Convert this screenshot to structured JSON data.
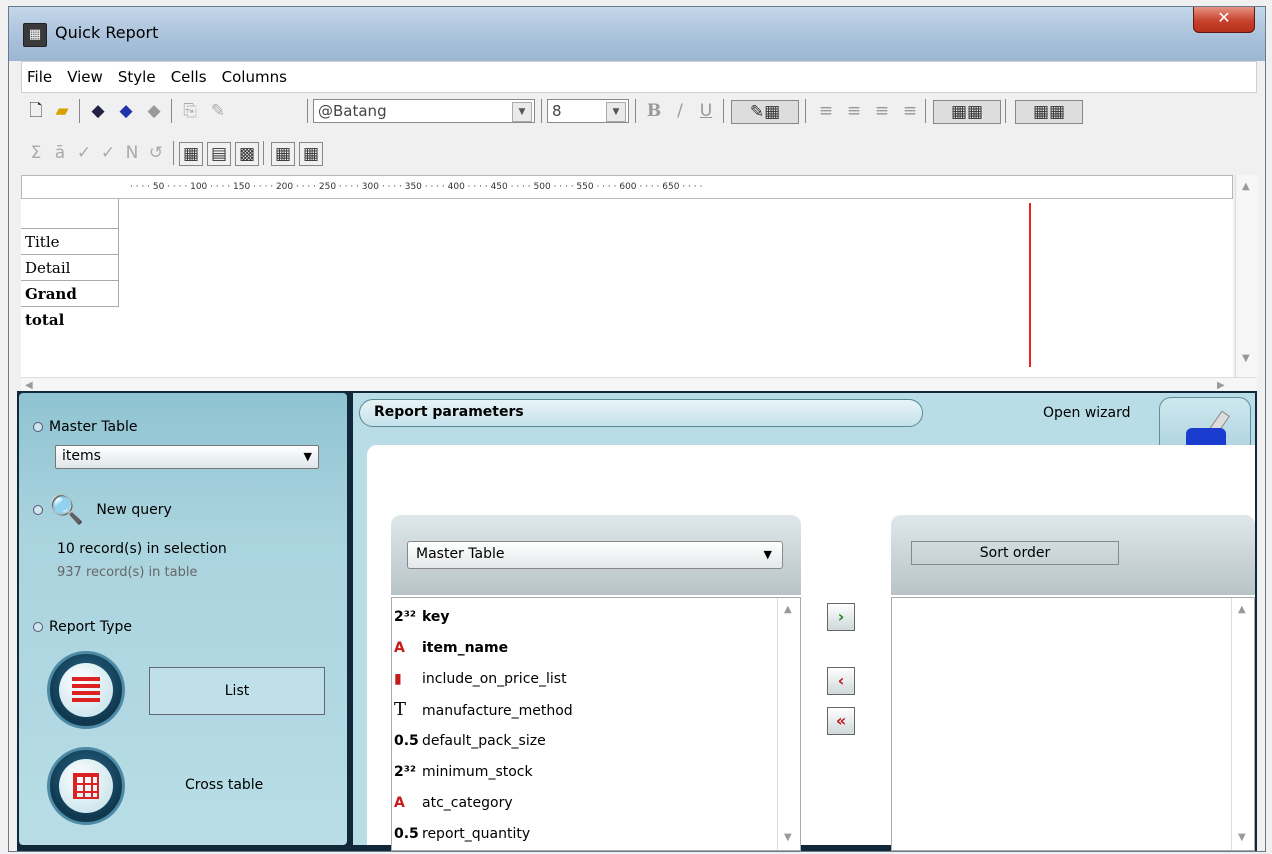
{
  "window": {
    "title": "Quick Report",
    "close_glyph": "✕"
  },
  "menu": [
    "File",
    "View",
    "Style",
    "Cells",
    "Columns"
  ],
  "toolbar": {
    "font": "@Batang",
    "font_size": "8",
    "bold": "B",
    "italic": "/",
    "underline": "U"
  },
  "ruler": {
    "marks": [
      "50",
      "100",
      "150",
      "200",
      "250",
      "300",
      "350",
      "400",
      "450",
      "500",
      "550",
      "600",
      "650"
    ]
  },
  "sections": [
    "Title",
    "Detail",
    "Grand total"
  ],
  "left": {
    "master_table_label": "Master Table",
    "master_table_value": "items",
    "new_query_label": "New query",
    "records_selection": "10 record(s) in selection",
    "records_table": "937 record(s) in table",
    "report_type_label": "Report Type",
    "list_label": "List",
    "cross_table_label": "Cross table"
  },
  "params": {
    "tab_label": "Report parameters",
    "open_wizard": "Open wizard",
    "field_source": "Master Table",
    "sort_order_label": "Sort order"
  },
  "fields": [
    {
      "type": "2³²",
      "name": "key",
      "bold": true,
      "icon": "integer-icon"
    },
    {
      "type": "A",
      "name": "item_name",
      "bold": true,
      "icon": "text-icon"
    },
    {
      "type": "▮",
      "name": "include_on_price_list",
      "bold": false,
      "icon": "boolean-icon"
    },
    {
      "type": "T",
      "name": "manufacture_method",
      "bold": false,
      "icon": "text-block-icon"
    },
    {
      "type": "0.5",
      "name": "default_pack_size",
      "bold": false,
      "icon": "real-icon"
    },
    {
      "type": "2³²",
      "name": "minimum_stock",
      "bold": false,
      "icon": "integer-icon"
    },
    {
      "type": "A",
      "name": "atc_category",
      "bold": false,
      "icon": "text-icon"
    },
    {
      "type": "0.5",
      "name": "report_quantity",
      "bold": false,
      "icon": "real-icon"
    }
  ],
  "buttons": {
    "add": "›",
    "remove": "‹",
    "remove_all": "«"
  },
  "colors": {
    "accent_red": "#d22222",
    "panel_teal": "#b8dde6",
    "frame_dark": "#10283a"
  }
}
